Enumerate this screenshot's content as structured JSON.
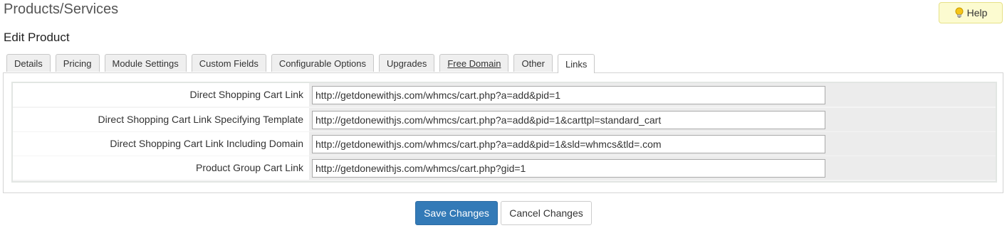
{
  "page": {
    "title": "Products/Services",
    "subtitle": "Edit Product",
    "help_label": "Help",
    "help_icon": "lightbulb-icon"
  },
  "tabs": [
    {
      "label": "Details"
    },
    {
      "label": "Pricing"
    },
    {
      "label": "Module Settings"
    },
    {
      "label": "Custom Fields"
    },
    {
      "label": "Configurable Options"
    },
    {
      "label": "Upgrades"
    },
    {
      "label": "Free Domain"
    },
    {
      "label": "Other"
    },
    {
      "label": "Links",
      "active": true
    }
  ],
  "links": [
    {
      "label": "Direct Shopping Cart Link",
      "value": "http://getdonewithjs.com/whmcs/cart.php?a=add&pid=1"
    },
    {
      "label": "Direct Shopping Cart Link Specifying Template",
      "value": "http://getdonewithjs.com/whmcs/cart.php?a=add&pid=1&carttpl=standard_cart"
    },
    {
      "label": "Direct Shopping Cart Link Including Domain",
      "value": "http://getdonewithjs.com/whmcs/cart.php?a=add&pid=1&sld=whmcs&tld=.com"
    },
    {
      "label": "Product Group Cart Link",
      "value": "http://getdonewithjs.com/whmcs/cart.php?gid=1"
    }
  ],
  "actions": {
    "save_label": "Save Changes",
    "cancel_label": "Cancel Changes"
  },
  "colors": {
    "primary": "#337ab7",
    "help_bg": "#fcfbd0"
  }
}
